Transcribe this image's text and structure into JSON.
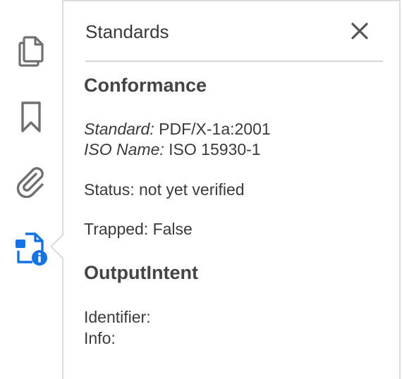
{
  "sidebar": {
    "icons": [
      {
        "name": "pages-icon",
        "label": ""
      },
      {
        "name": "bookmark-icon",
        "label": ""
      },
      {
        "name": "attachment-icon",
        "label": ""
      },
      {
        "name": "standards-icon",
        "label": "",
        "active": true,
        "color": "#1473e6"
      }
    ],
    "icon_color": "#707070"
  },
  "panel": {
    "title": "Standards",
    "close_icon": "close-icon",
    "conformance": {
      "heading": "Conformance",
      "standard_label": "Standard:",
      "standard_value": "PDF/X-1a:2001",
      "iso_label": "ISO Name:",
      "iso_value": "ISO 15930-1",
      "status": "Status: not yet verified",
      "trapped": "Trapped: False"
    },
    "output_intent": {
      "heading": "OutputIntent",
      "identifier": "Identifier:",
      "info": "Info:"
    }
  }
}
